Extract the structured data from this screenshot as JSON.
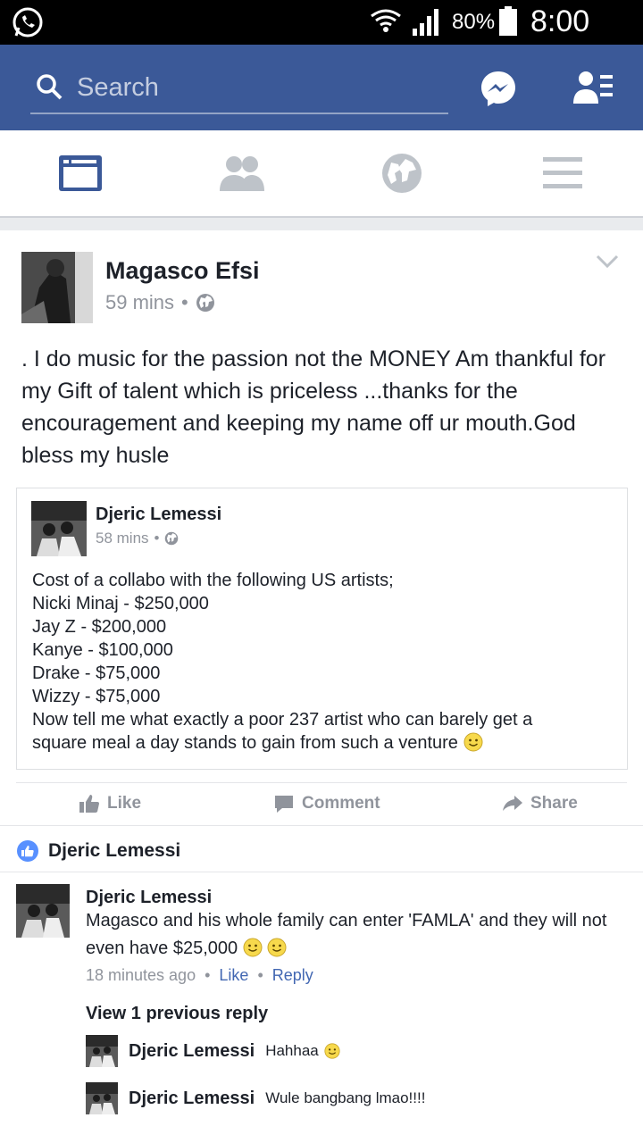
{
  "status_bar": {
    "battery_percent": "80%",
    "time": "8:00 PM"
  },
  "app_bar": {
    "search_placeholder": "Search"
  },
  "post": {
    "author": "Magasco Efsi",
    "time": "59 mins",
    "separator": "•",
    "text": ". I do music for the passion not the MONEY Am thankful for my Gift of talent which is priceless ...thanks for the encouragement and keeping my name off ur mouth.God bless my husle",
    "shared": {
      "author": "Djeric Lemessi",
      "time": "58 mins",
      "lines": [
        "Cost of a collabo with the following US artists;",
        "Nicki Minaj - $250,000",
        "Jay Z - $200,000",
        "Kanye - $100,000",
        "Drake -  $75,000",
        "Wizzy - $75,000",
        "Now tell me what exactly a poor 237 artist who can barely get a",
        "square meal a day stands to gain from such a venture"
      ]
    },
    "actions": {
      "like": "Like",
      "comment": "Comment",
      "share": "Share"
    }
  },
  "reactions": {
    "reactor": "Djeric Lemessi"
  },
  "comment": {
    "author": "Djeric Lemessi",
    "text": "Magasco  and his whole family can enter 'FAMLA' and they will not even have $25,000",
    "time": "18 minutes ago",
    "like": "Like",
    "reply": "Reply",
    "dot": "•",
    "view_previous": "View 1 previous reply",
    "replies": [
      {
        "author": "Djeric Lemessi",
        "text": "Hahhaa"
      },
      {
        "author": "Djeric Lemessi",
        "text": "Wule bangbang lmao!!!!"
      }
    ]
  },
  "colors": {
    "brand": "#3b5998",
    "link": "#4267b2",
    "muted": "#90949c"
  }
}
